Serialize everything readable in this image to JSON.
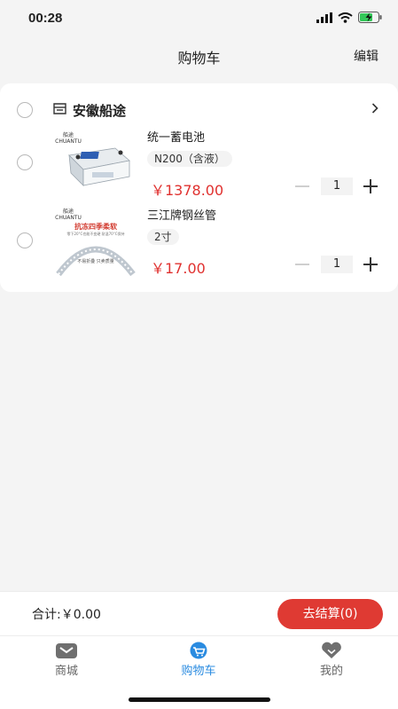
{
  "status_bar": {
    "time": "00:28"
  },
  "nav": {
    "title": "购物车",
    "edit": "编辑"
  },
  "store": {
    "name": "安徽船途"
  },
  "products": [
    {
      "title": "统一蓄电池",
      "spec": "N200（含液）",
      "price": "￥1378.00",
      "qty": "1",
      "brand_mark": "船途",
      "brand_en": "CHUANTU"
    },
    {
      "title": "三江牌钢丝管",
      "spec": "2寸",
      "price": "￥17.00",
      "qty": "1",
      "brand_mark": "船途",
      "brand_en": "CHUANTU",
      "promo_title": "抗冻四季柔软",
      "promo_sub": "零下20°C也能不变硬 耐温70°C保持",
      "promo_foot": "不易折叠 只卖质量"
    }
  ],
  "checkout": {
    "total": "合计:￥0.00",
    "button": "去结算(0)"
  },
  "tabs": [
    {
      "label": "商城",
      "active": false
    },
    {
      "label": "购物车",
      "active": true
    },
    {
      "label": "我的",
      "active": false
    }
  ],
  "colors": {
    "accent": "#2a8be0",
    "price": "#e0312f",
    "checkout": "#df3a33"
  }
}
